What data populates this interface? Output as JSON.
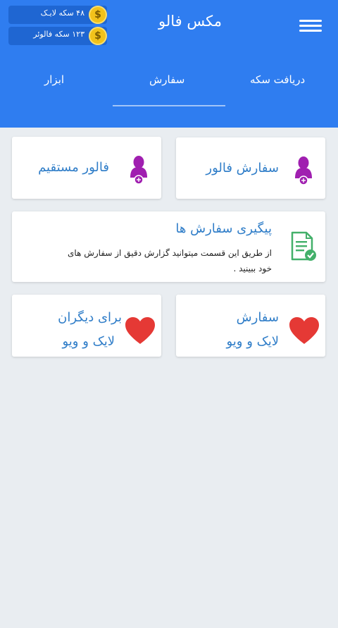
{
  "header": {
    "title": "مکس فالو",
    "coins": [
      {
        "text": "۴۸ سکه لایـک",
        "symbol": "$"
      },
      {
        "text": "۱۲۳ سکه فالوئر",
        "symbol": "$"
      }
    ]
  },
  "tabs": [
    {
      "label": "دریافت سکه"
    },
    {
      "label": "سفارش"
    },
    {
      "label": "ابزار"
    }
  ],
  "cards": {
    "order_follow": {
      "title": "سفارش فالور"
    },
    "direct_follow": {
      "title": "فالور مستقیم"
    },
    "tracking": {
      "title": "پیگیری سفارش ها",
      "desc": "از طریق این قسمت میتوانید گزارش دقیق از سفارش های خود ببینید ."
    },
    "like_view": {
      "title_line1": "سفارش",
      "title_line2": "لایک و ویو"
    },
    "like_view_others": {
      "title_line1": "برای دیگران",
      "title_line2": "لایک و ویو"
    }
  },
  "colors": {
    "header_bg": "#2f7df0",
    "accent_text": "#2f7dc8",
    "person_icon": "#a01fb0",
    "heart": "#e53935",
    "doc_icon": "#43b06a"
  }
}
